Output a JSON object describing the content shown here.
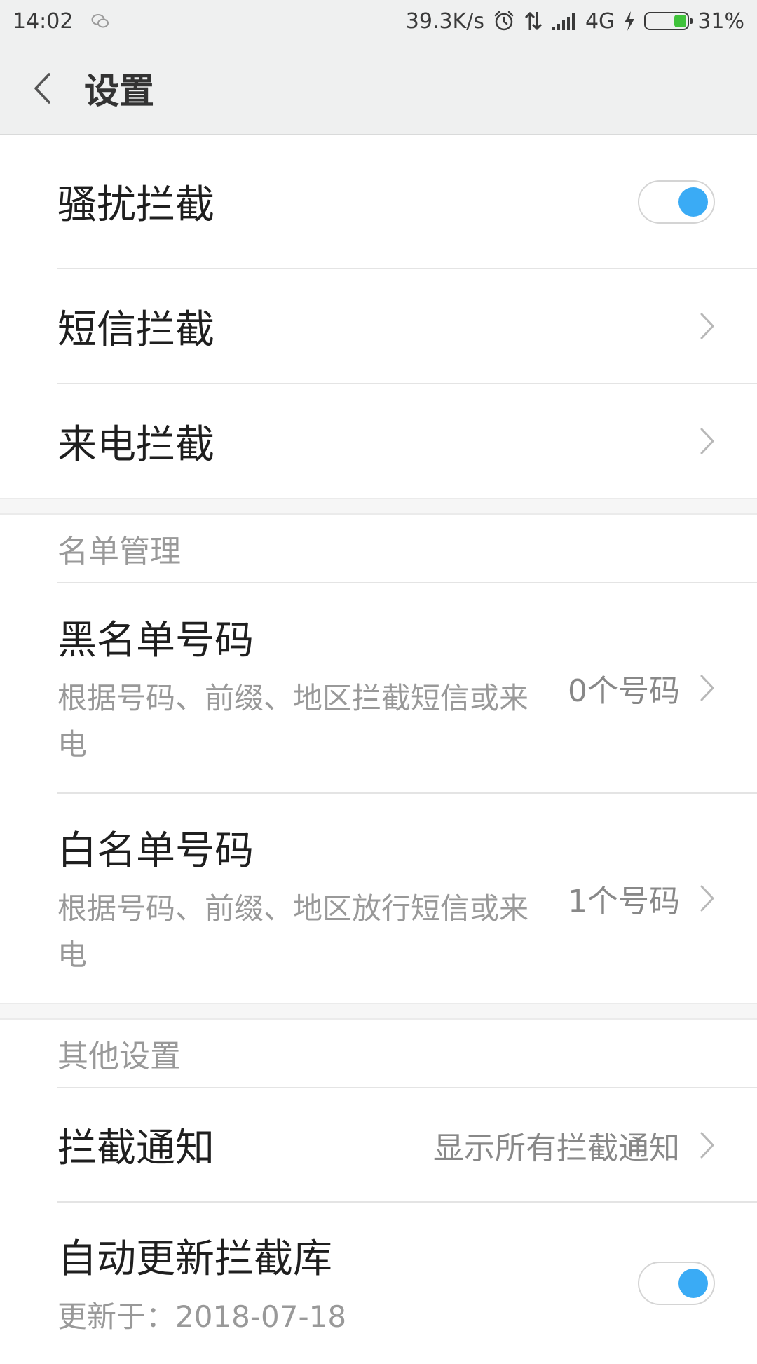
{
  "status_bar": {
    "time": "14:02",
    "network_speed": "39.3K/s",
    "network_type": "4G",
    "battery_percent": "31%",
    "battery_level": 0.31,
    "icons": [
      "wechat-icon",
      "alarm-icon",
      "data-transfer-icon",
      "signal-icon",
      "charging-icon",
      "battery-icon"
    ]
  },
  "header": {
    "title": "设置",
    "back_icon": "chevron-left-icon"
  },
  "colors": {
    "toggle_on": "#3aabf5",
    "header_bg": "#eff0f0",
    "battery_fill": "#3fc23a"
  },
  "rows": {
    "harassment": {
      "label": "骚扰拦截",
      "toggle_on": true
    },
    "sms": {
      "label": "短信拦截"
    },
    "call": {
      "label": "来电拦截"
    }
  },
  "list_management": {
    "header": "名单管理",
    "blacklist": {
      "label": "黑名单号码",
      "subtitle": "根据号码、前缀、地区拦截短信或来电",
      "value": "0个号码"
    },
    "whitelist": {
      "label": "白名单号码",
      "subtitle": "根据号码、前缀、地区放行短信或来电",
      "value": "1个号码"
    }
  },
  "other_settings": {
    "header": "其他设置",
    "notification": {
      "label": "拦截通知",
      "value": "显示所有拦截通知"
    },
    "auto_update": {
      "label": "自动更新拦截库",
      "subtitle": "更新于：2018-07-18",
      "toggle_on": true
    }
  }
}
